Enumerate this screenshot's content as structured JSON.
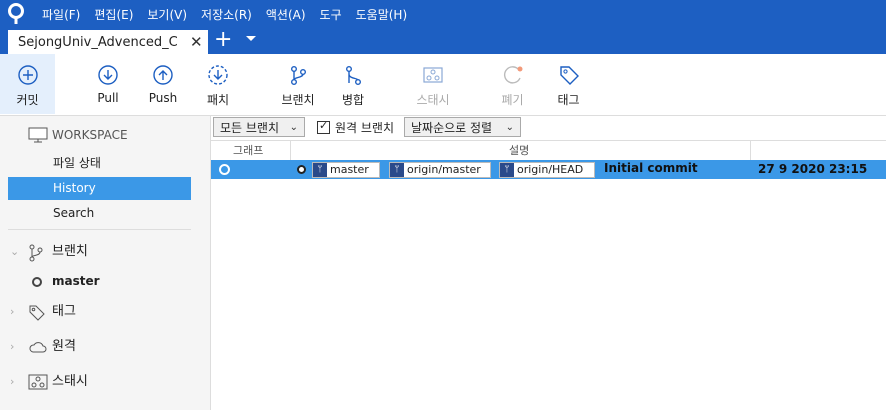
{
  "menu": [
    "파일(F)",
    "편집(E)",
    "보기(V)",
    "저장소(R)",
    "액션(A)",
    "도구",
    "도움말(H)"
  ],
  "tab": {
    "title": "SejongUniv_Advenced_C",
    "close": "✕",
    "add": "+"
  },
  "toolbar": {
    "commit": "커밋",
    "pull": "Pull",
    "push": "Push",
    "fetch": "패치",
    "branch": "브랜치",
    "merge": "병합",
    "stash": "스태시",
    "discard": "폐기",
    "tag": "태그"
  },
  "sidebar": {
    "workspace": "WORKSPACE",
    "file_status": "파일 상태",
    "history": "History",
    "search": "Search",
    "branches": "브랜치",
    "master": "master",
    "tags": "태그",
    "remotes": "원격",
    "stashes": "스태시"
  },
  "filter": {
    "all_branches": "모든 브랜치",
    "remote_branches": "원격 브랜치",
    "sort": "날짜순으로 정렬"
  },
  "grid": {
    "col_graph": "그래프",
    "col_desc": "설명"
  },
  "commit": {
    "refs": [
      "master",
      "origin/master",
      "origin/HEAD"
    ],
    "message": "Initial commit",
    "date": "27 9 2020 23:15"
  },
  "colors": {
    "accent": "#1d5fc2",
    "selection": "#3b98e7"
  }
}
